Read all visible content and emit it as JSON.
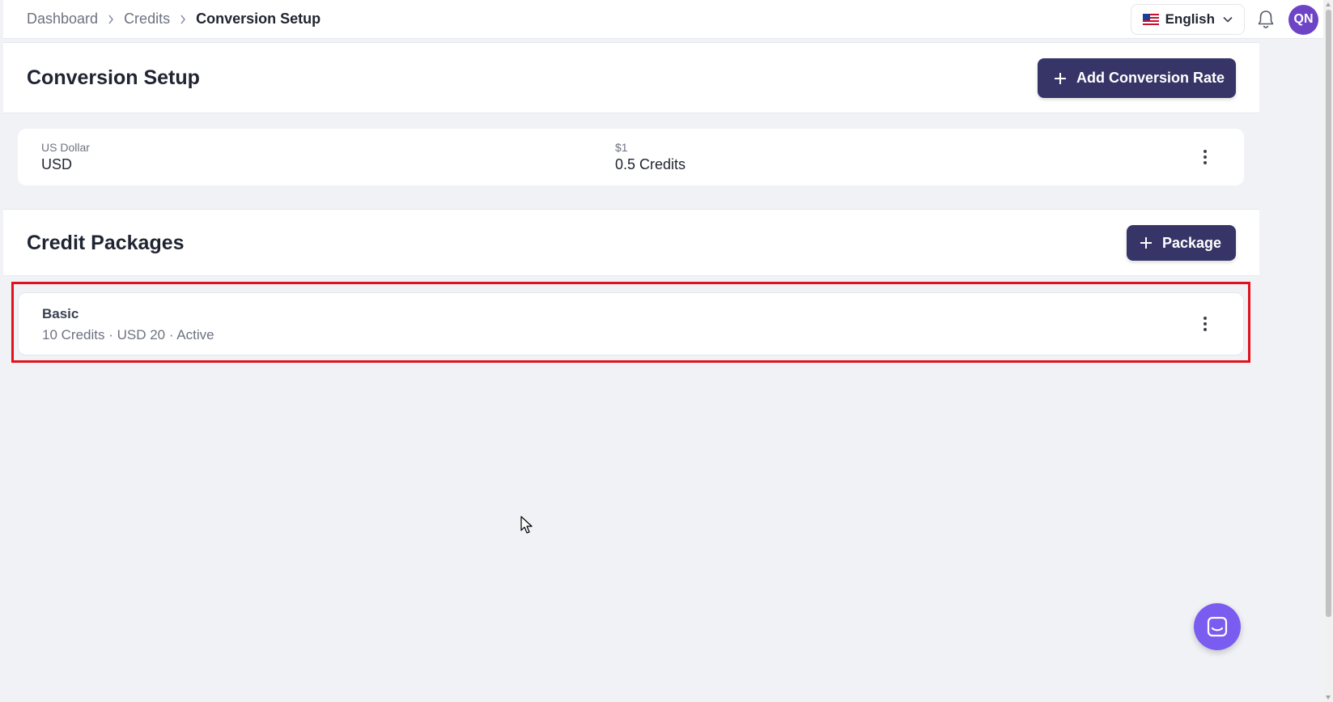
{
  "breadcrumb": {
    "items": [
      "Dashboard",
      "Credits"
    ],
    "current": "Conversion Setup"
  },
  "header": {
    "language": "English",
    "avatar_initials": "QN"
  },
  "conversion_section": {
    "title": "Conversion Setup",
    "add_button_label": "Add Conversion Rate",
    "rates": [
      {
        "currency_name": "US Dollar",
        "currency_code": "USD",
        "amount_label": "$1",
        "credits": "0.5 Credits"
      }
    ]
  },
  "packages_section": {
    "title": "Credit Packages",
    "add_button_label": "Package",
    "packages": [
      {
        "name": "Basic",
        "details": "10 Credits · USD 20 · Active"
      }
    ]
  },
  "colors": {
    "primary_button": "#373567",
    "avatar": "#6d44c5",
    "chat_button": "#7a5cf0",
    "highlight": "#e1121c"
  },
  "icons": [
    "chevron-right-icon",
    "us-flag-icon",
    "chevron-down-icon",
    "bell-icon",
    "plus-icon",
    "kebab-menu-icon",
    "chat-icon",
    "mouse-cursor-icon"
  ]
}
